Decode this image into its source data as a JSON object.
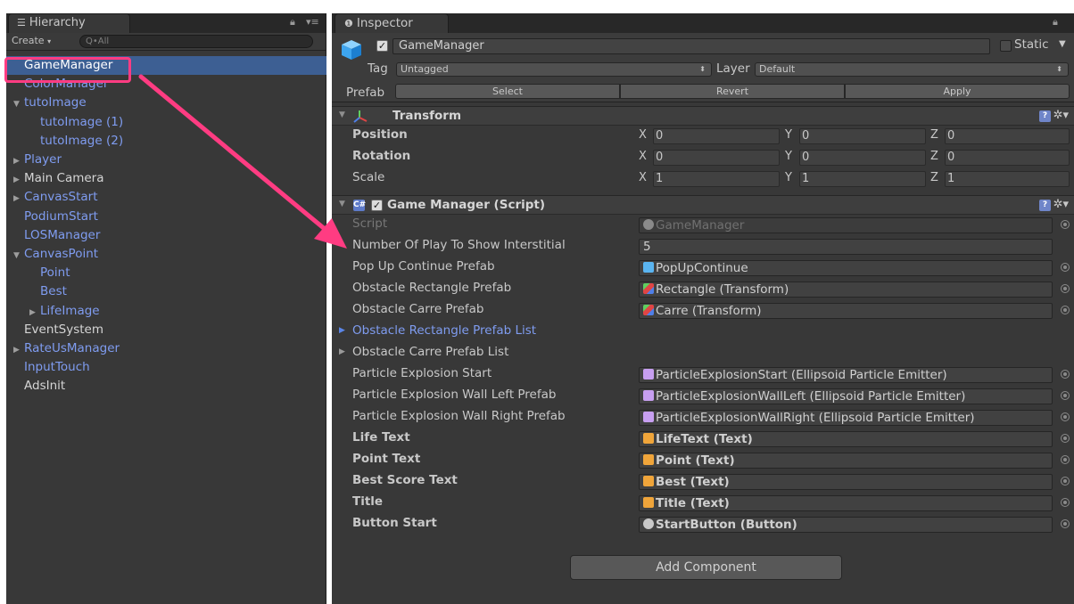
{
  "hierarchy": {
    "tab_title": "Hierarchy",
    "create_label": "Create",
    "search_placeholder": "Q•All",
    "items": [
      {
        "label": "GameManager",
        "indent": 0,
        "color": "white",
        "fold": "",
        "selected": true
      },
      {
        "label": "ColorManager",
        "indent": 0,
        "color": "blue",
        "fold": ""
      },
      {
        "label": "tutoImage",
        "indent": 0,
        "color": "blue",
        "fold": "open"
      },
      {
        "label": "tutoImage (1)",
        "indent": 1,
        "color": "blue",
        "fold": ""
      },
      {
        "label": "tutoImage (2)",
        "indent": 1,
        "color": "blue",
        "fold": ""
      },
      {
        "label": "Player",
        "indent": 0,
        "color": "blue",
        "fold": "closed"
      },
      {
        "label": "Main Camera",
        "indent": 0,
        "color": "white",
        "fold": "closed"
      },
      {
        "label": "CanvasStart",
        "indent": 0,
        "color": "blue",
        "fold": "closed"
      },
      {
        "label": "PodiumStart",
        "indent": 0,
        "color": "blue",
        "fold": ""
      },
      {
        "label": "LOSManager",
        "indent": 0,
        "color": "blue",
        "fold": ""
      },
      {
        "label": "CanvasPoint",
        "indent": 0,
        "color": "blue",
        "fold": "open"
      },
      {
        "label": "Point",
        "indent": 1,
        "color": "blue",
        "fold": ""
      },
      {
        "label": "Best",
        "indent": 1,
        "color": "blue",
        "fold": ""
      },
      {
        "label": "LifeImage",
        "indent": 1,
        "color": "blue",
        "fold": "closed"
      },
      {
        "label": "EventSystem",
        "indent": 0,
        "color": "white",
        "fold": ""
      },
      {
        "label": "RateUsManager",
        "indent": 0,
        "color": "blue",
        "fold": "closed"
      },
      {
        "label": "InputTouch",
        "indent": 0,
        "color": "blue",
        "fold": ""
      },
      {
        "label": "AdsInit",
        "indent": 0,
        "color": "white",
        "fold": ""
      }
    ]
  },
  "inspector": {
    "tab_title": "Inspector",
    "object_name": "GameManager",
    "static_label": "Static",
    "tag_label": "Tag",
    "tag_value": "Untagged",
    "layer_label": "Layer",
    "layer_value": "Default",
    "prefab_label": "Prefab",
    "prefab_buttons": [
      "Select",
      "Revert",
      "Apply"
    ],
    "transform": {
      "title": "Transform",
      "rows": [
        {
          "label": "Position",
          "x": "0",
          "y": "0",
          "z": "0"
        },
        {
          "label": "Rotation",
          "x": "0",
          "y": "0",
          "z": "0"
        },
        {
          "label": "Scale",
          "x": "1",
          "y": "1",
          "z": "1"
        }
      ]
    },
    "script_component": {
      "title": "Game Manager (Script)",
      "fields": [
        {
          "label": "Script",
          "value": "GameManager",
          "style": "dim",
          "icon": "script",
          "picker": true
        },
        {
          "label": "Number Of Play To Show Interstitial",
          "value": "5",
          "style": "normal",
          "icon": "",
          "picker": false
        },
        {
          "label": "Pop Up Continue Prefab",
          "value": "PopUpContinue",
          "style": "normal",
          "icon": "prefab",
          "picker": true
        },
        {
          "label": "Obstacle Rectangle Prefab",
          "value": "Rectangle (Transform)",
          "style": "normal",
          "icon": "transform",
          "picker": true
        },
        {
          "label": "Obstacle Carre Prefab",
          "value": "Carre (Transform)",
          "style": "normal",
          "icon": "transform",
          "picker": true
        },
        {
          "label": "Obstacle Rectangle Prefab List",
          "value": "",
          "style": "link",
          "icon": "",
          "picker": false,
          "fold": "blue"
        },
        {
          "label": "Obstacle Carre Prefab List",
          "value": "",
          "style": "normal",
          "icon": "",
          "picker": false,
          "fold": "gray"
        },
        {
          "label": "Particle Explosion Start",
          "value": "ParticleExplosionStart (Ellipsoid Particle Emitter)",
          "style": "normal",
          "icon": "particle",
          "picker": true
        },
        {
          "label": "Particle Explosion Wall Left Prefab",
          "value": "ParticleExplosionWallLeft (Ellipsoid Particle Emitter)",
          "style": "normal",
          "icon": "particle",
          "picker": true
        },
        {
          "label": "Particle Explosion Wall Right Prefab",
          "value": "ParticleExplosionWallRight (Ellipsoid Particle Emitter)",
          "style": "normal",
          "icon": "particle",
          "picker": true
        },
        {
          "label": "Life Text",
          "value": "LifeText (Text)",
          "style": "bold",
          "icon": "text",
          "picker": true
        },
        {
          "label": "Point Text",
          "value": "Point (Text)",
          "style": "bold",
          "icon": "text",
          "picker": true
        },
        {
          "label": "Best Score Text",
          "value": "Best (Text)",
          "style": "bold",
          "icon": "text",
          "picker": true
        },
        {
          "label": "Title",
          "value": "Title (Text)",
          "style": "bold",
          "icon": "text",
          "picker": true
        },
        {
          "label": "Button Start",
          "value": "StartButton (Button)",
          "style": "bold",
          "icon": "button",
          "picker": true
        }
      ]
    },
    "add_component_label": "Add Component"
  },
  "colors": {
    "annotation": "#ff3c82",
    "selection": "#3d5f93",
    "prefab_blue": "#7f9cf0"
  }
}
